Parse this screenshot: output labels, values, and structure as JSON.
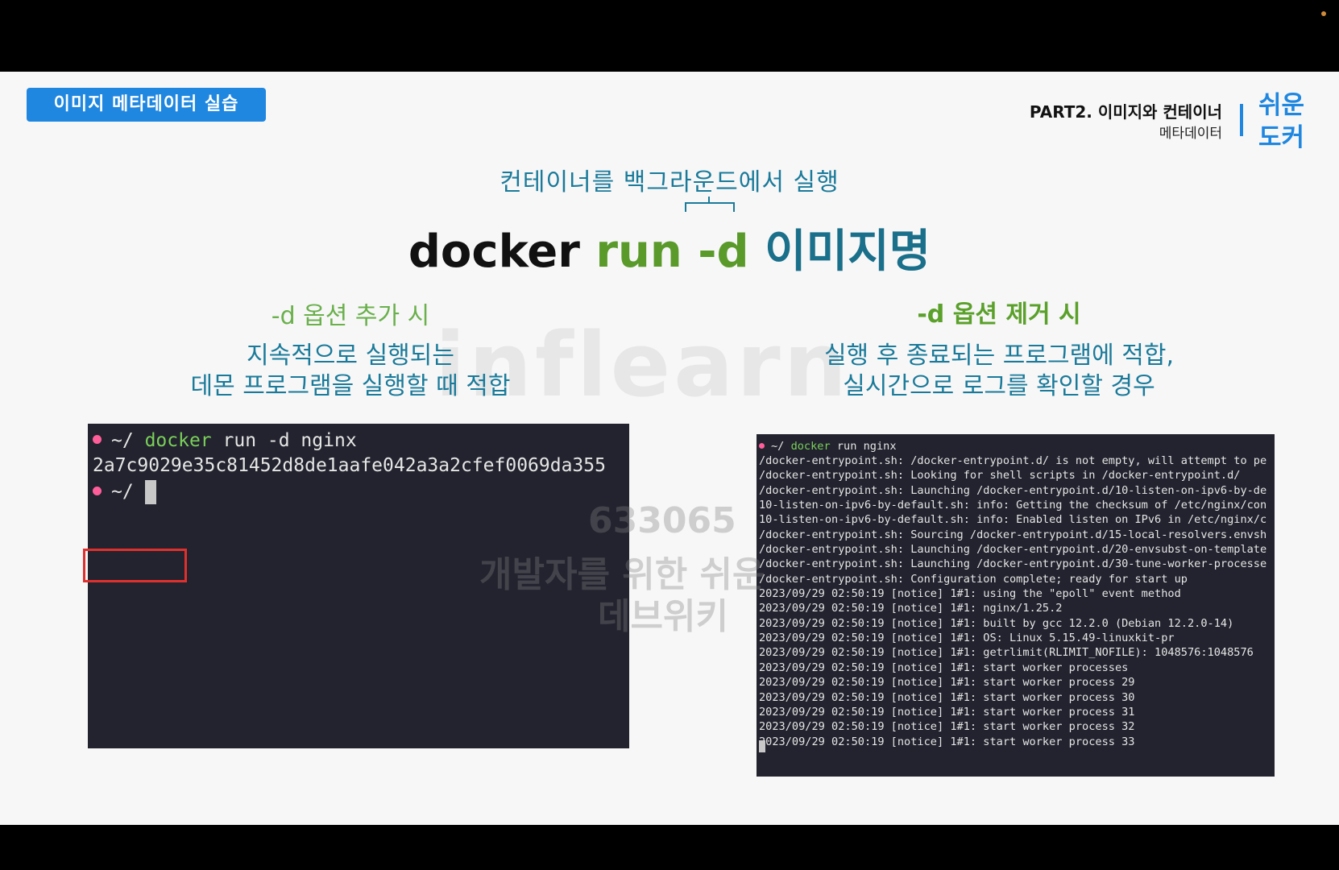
{
  "header": {
    "badge": "이미지 메타데이터 실습",
    "part_title": "PART2. 이미지와 컨테이너",
    "part_subtitle": "메타데이터",
    "logo_line1": "쉬운",
    "logo_line2": "도커"
  },
  "main": {
    "top_caption": "컨테이너를 백그라운드에서 실행",
    "command": {
      "docker": "docker",
      "run": "run -d",
      "image": "이미지명"
    },
    "watermark": "inflearn",
    "watermark_id": "633065",
    "watermark_line2": "개발자를 위한 쉬운",
    "watermark_line3": "데브위키"
  },
  "left": {
    "heading": "-d 옵션 추가 시",
    "desc_line1": "지속적으로 실행되는",
    "desc_line2": "데몬 프로그램을 실행할 때 적합",
    "terminal": {
      "prompt": "~/",
      "cmd_docker": "docker",
      "cmd_rest": " run -d nginx",
      "output": "2a7c9029e35c81452d8de1aafe042a3a2cfef0069da355",
      "prompt2": "~/"
    }
  },
  "right": {
    "heading": "-d 옵션 제거 시",
    "desc_line1": "실행 후 종료되는 프로그램에 적합,",
    "desc_line2": "실시간으로 로그를 확인할 경우",
    "terminal": {
      "prompt": "~/",
      "cmd_docker": "docker",
      "cmd_rest": " run nginx",
      "lines": [
        "/docker-entrypoint.sh: /docker-entrypoint.d/ is not empty, will attempt to pe",
        "/docker-entrypoint.sh: Looking for shell scripts in /docker-entrypoint.d/",
        "/docker-entrypoint.sh: Launching /docker-entrypoint.d/10-listen-on-ipv6-by-de",
        "10-listen-on-ipv6-by-default.sh: info: Getting the checksum of /etc/nginx/con",
        "10-listen-on-ipv6-by-default.sh: info: Enabled listen on IPv6 in /etc/nginx/c",
        "/docker-entrypoint.sh: Sourcing /docker-entrypoint.d/15-local-resolvers.envsh",
        "/docker-entrypoint.sh: Launching /docker-entrypoint.d/20-envsubst-on-template",
        "/docker-entrypoint.sh: Launching /docker-entrypoint.d/30-tune-worker-processe",
        "/docker-entrypoint.sh: Configuration complete; ready for start up",
        "2023/09/29 02:50:19 [notice] 1#1: using the \"epoll\" event method",
        "2023/09/29 02:50:19 [notice] 1#1: nginx/1.25.2",
        "2023/09/29 02:50:19 [notice] 1#1: built by gcc 12.2.0 (Debian 12.2.0-14)",
        "2023/09/29 02:50:19 [notice] 1#1: OS: Linux 5.15.49-linuxkit-pr",
        "2023/09/29 02:50:19 [notice] 1#1: getrlimit(RLIMIT_NOFILE): 1048576:1048576",
        "2023/09/29 02:50:19 [notice] 1#1: start worker processes",
        "2023/09/29 02:50:19 [notice] 1#1: start worker process 29",
        "2023/09/29 02:50:19 [notice] 1#1: start worker process 30",
        "2023/09/29 02:50:19 [notice] 1#1: start worker process 31",
        "2023/09/29 02:50:19 [notice] 1#1: start worker process 32",
        "2023/09/29 02:50:19 [notice] 1#1: start worker process 33"
      ]
    }
  },
  "colors": {
    "accent_blue": "#1f87e0",
    "teal_text": "#1a7a9a",
    "green_text": "#5a9a2a",
    "terminal_bg": "#22232e",
    "highlight_red": "#e0302e"
  }
}
